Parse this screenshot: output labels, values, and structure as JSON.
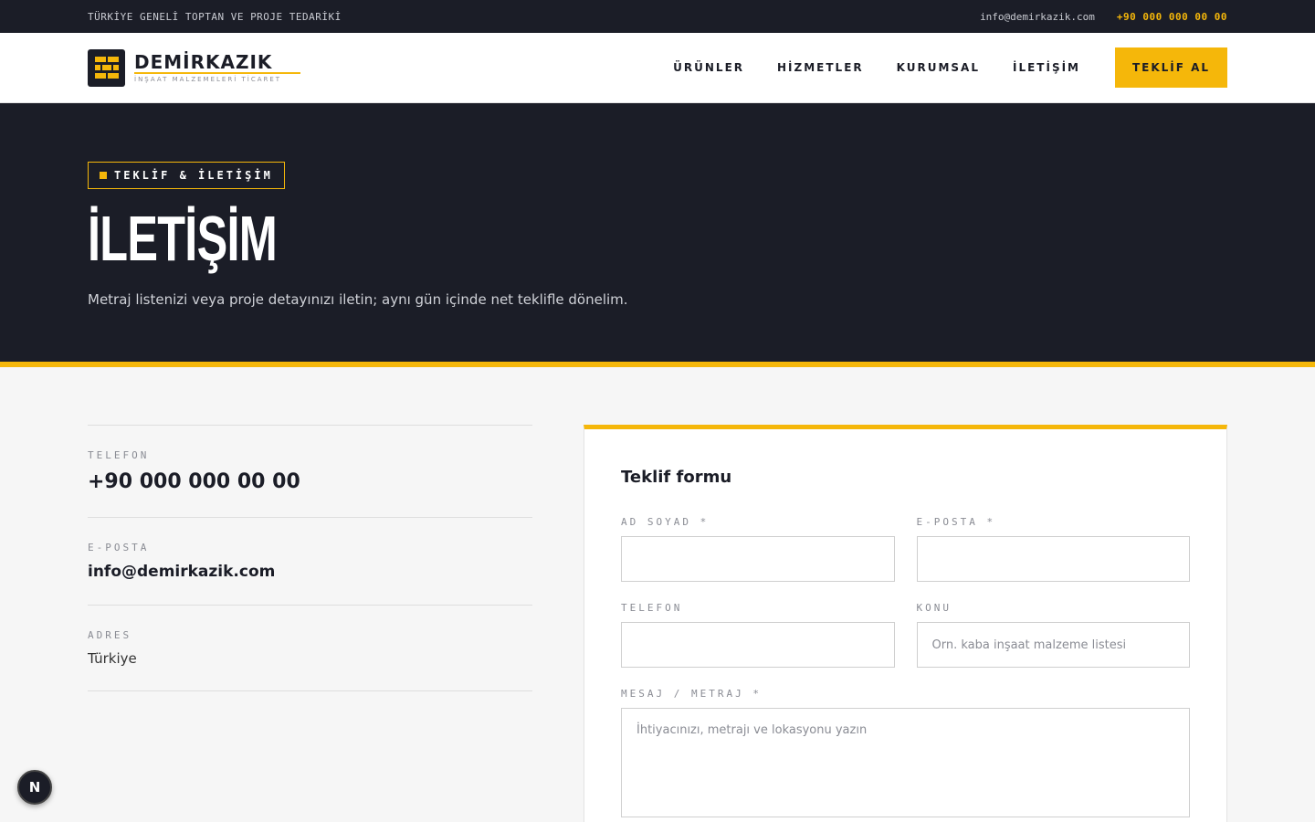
{
  "topbar": {
    "tagline": "TÜRKİYE GENELİ TOPTAN VE PROJE TEDARİKİ",
    "email": "info@demirkazik.com",
    "phone": "+90 000 000 00 00"
  },
  "header": {
    "brand_name": "DEMİRKAZIK",
    "brand_sub": "İNŞAAT MALZEMELERİ TİCARET",
    "logo_icon": "brick-wall-icon",
    "nav": [
      "ÜRÜNLER",
      "HİZMETLER",
      "KURUMSAL",
      "İLETİŞİM"
    ],
    "cta_label": "TEKLİF AL"
  },
  "hero": {
    "badge": "TEKLİF & İLETİŞİM",
    "title": "İLETİŞİM",
    "subtitle": "Metraj listenizi veya proje detayınızı iletin; aynı gün içinde net teklifle dönelim."
  },
  "contact_info": {
    "phone_label": "TELEFON",
    "phone_value": "+90 000 000 00 00",
    "email_label": "E-POSTA",
    "email_value": "info@demirkazik.com",
    "address_label": "ADRES",
    "address_value": "Türkiye"
  },
  "form": {
    "title": "Teklif formu",
    "name_label": "AD SOYAD *",
    "email_label": "E-POSTA *",
    "phone_label": "TELEFON",
    "subject_label": "KONU",
    "subject_placeholder": "Örn. kaba inşaat malzeme listesi",
    "message_label": "MESAJ / METRAJ *",
    "message_placeholder": "İhtiyacınızı, metrajı ve lokasyonu yazın"
  },
  "floating_button": {
    "label": "N",
    "icon": "nextjs-logo-icon"
  },
  "colors": {
    "accent": "#f5b70a",
    "dark": "#1b1d27",
    "background": "#f6f6f6"
  }
}
